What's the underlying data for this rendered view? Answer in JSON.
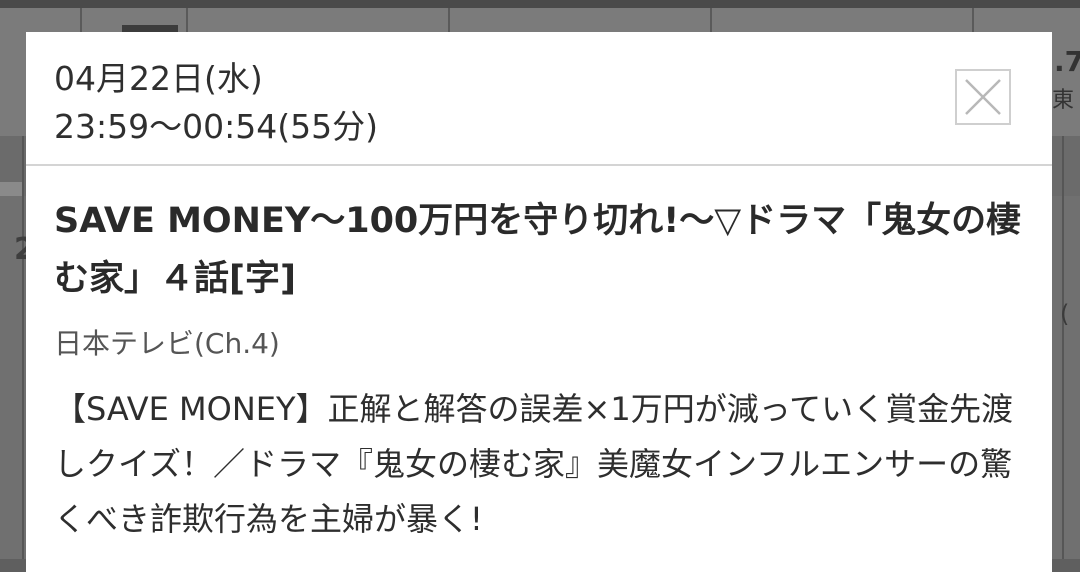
{
  "background": {
    "right_text_1": ".7",
    "right_text_2": "東",
    "row_number": "2",
    "right_glyph": "("
  },
  "modal": {
    "date": "04月22日(水)",
    "time": "23:59〜00:54(55分)",
    "close_icon": "close-icon",
    "title": "SAVE MONEY〜100万円を守り切れ!〜▽ドラマ「鬼女の棲む家」４話[字]",
    "channel": "日本テレビ(Ch.4)",
    "description": "【SAVE MONEY】正解と解答の誤差×1万円が減っていく賞金先渡しクイズ！／ドラマ『鬼女の棲む家』美魔女インフルエンサーの驚くべき詐欺行為を主婦が暴く!"
  },
  "colors": {
    "overlay": "#707070",
    "modal_bg": "#ffffff",
    "text": "#2e2e2e",
    "divider": "#d4d4d4"
  }
}
